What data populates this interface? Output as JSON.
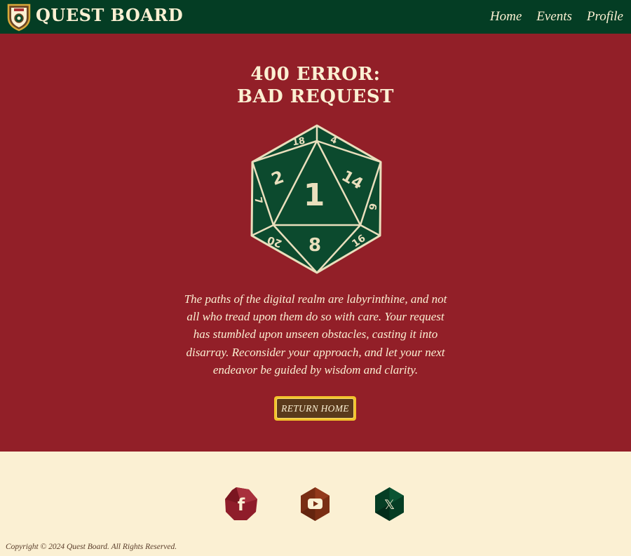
{
  "header": {
    "brand": "QUEST BOARD",
    "nav": [
      {
        "label": "Home"
      },
      {
        "label": "Events"
      },
      {
        "label": "Profile"
      }
    ]
  },
  "error": {
    "title_line1": "400 ERROR:",
    "title_line2": "BAD REQUEST",
    "die_faces": {
      "center": "1",
      "left": "2",
      "right": "14",
      "bottom": "8",
      "top_left": "18",
      "top_right": "4",
      "far_left": "7",
      "far_right": "9",
      "bottom_left": "20",
      "bottom_right": "16"
    },
    "message": "The paths of the digital realm are labyrinthine, and not all who tread upon them do so with care. Your request has stumbled upon unseen obstacles, casting it into disarray. Reconsider your approach, and let your next endeavor be guided by wisdom and clarity.",
    "button_label": "RETURN HOME"
  },
  "footer": {
    "social": [
      {
        "icon": "facebook-icon",
        "glyph": "f",
        "color": "#8f1d2a"
      },
      {
        "icon": "youtube-icon",
        "color": "#7a2e14"
      },
      {
        "icon": "x-icon",
        "glyph": "𝕏",
        "color": "#053d24"
      }
    ],
    "copyright": "Copyright © 2024 Quest Board. All Rights Reserved."
  },
  "colors": {
    "nav_bg": "#043d24",
    "main_bg": "#921f28",
    "footer_bg": "#fbf0d3",
    "accent_gold": "#f2c32b",
    "text_cream": "#fbf0d3"
  }
}
